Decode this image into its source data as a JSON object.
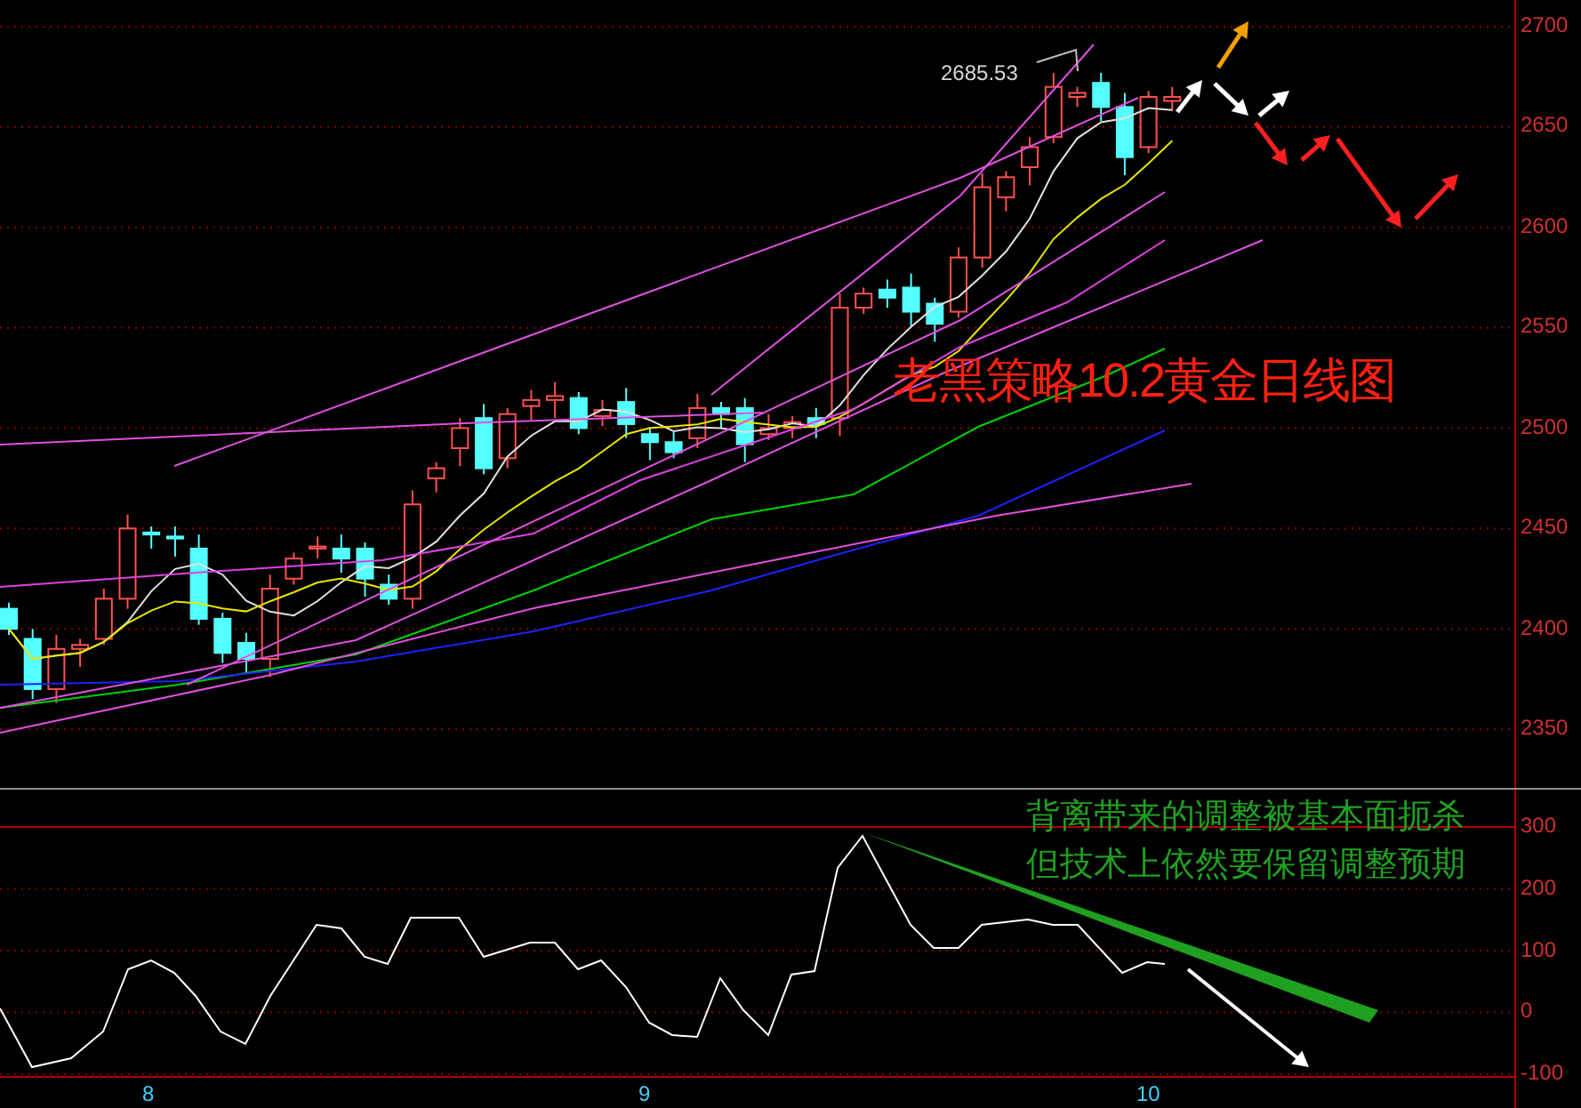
{
  "price_axis": {
    "labels": [
      "2700",
      "2650",
      "2600",
      "2550",
      "2500",
      "2450",
      "2400",
      "2350"
    ]
  },
  "indicator_axis": {
    "labels": [
      "300",
      "200",
      "100",
      "0",
      "-100"
    ]
  },
  "time_axis": {
    "labels": [
      "8",
      "9",
      "10"
    ]
  },
  "high_label": "2685.53",
  "title": "老黑策略10.2黄金日线图",
  "note": [
    "背离带来的调整被基本面扼杀",
    "但技术上依然要保留调整预期"
  ]
}
